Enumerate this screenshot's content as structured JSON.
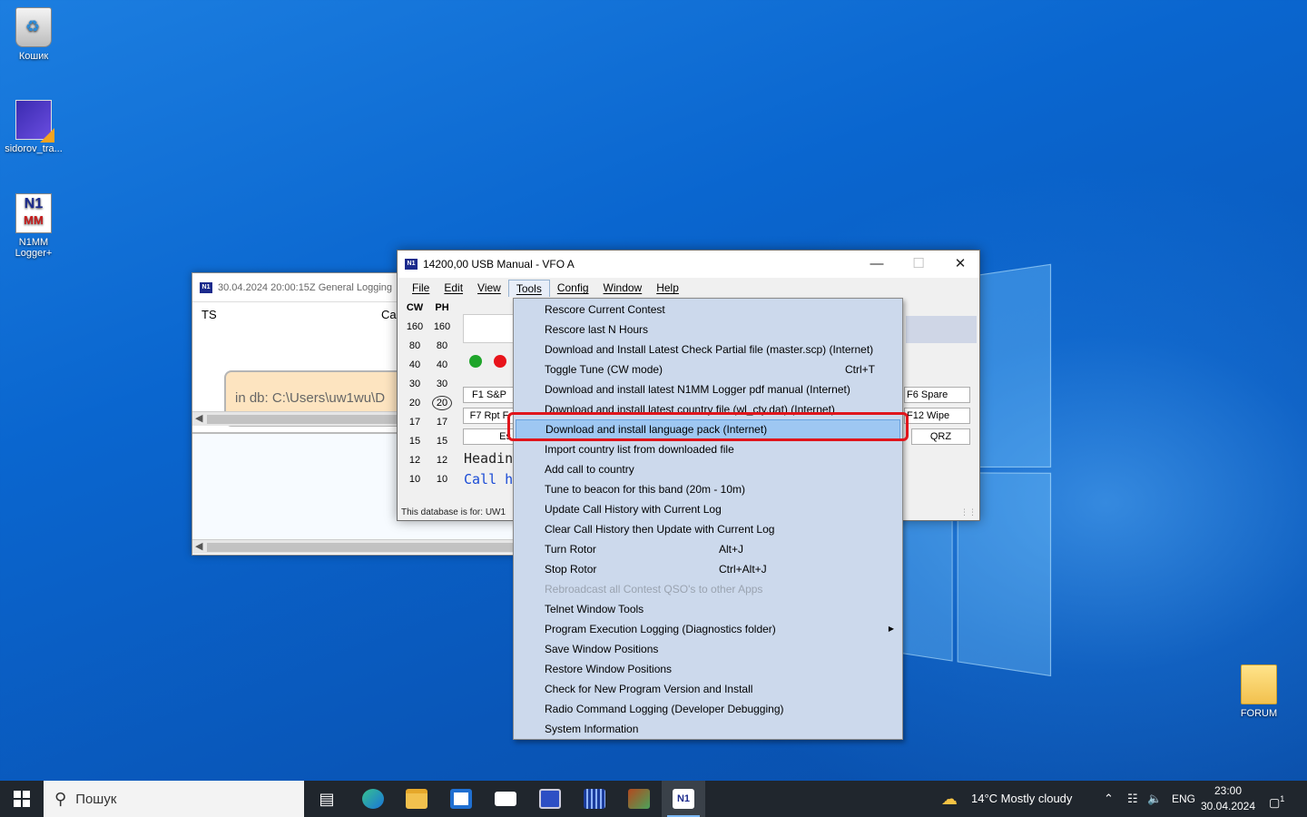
{
  "desktop": {
    "icons": [
      {
        "label": "Кошик"
      },
      {
        "label": "sidorov_tra..."
      },
      {
        "label": "N1MM Logger+"
      },
      {
        "label": "FORUM"
      }
    ]
  },
  "log_window": {
    "title": "30.04.2024 20:00:15Z  General Logging",
    "col_ts": "TS",
    "col_call": "Ca",
    "tooltip": "in db: C:\\Users\\uw1wu\\D"
  },
  "entry_window": {
    "title": "14200,00 USB Manual - VFO A",
    "logo": "N1",
    "menu": [
      "File",
      "Edit",
      "View",
      "Tools",
      "Config",
      "Window",
      "Help"
    ],
    "band_headers": [
      "CW",
      "PH"
    ],
    "bands_cw": [
      "160",
      "80",
      "40",
      "30",
      "20",
      "17",
      "15",
      "12",
      "10"
    ],
    "bands_ph": [
      "160",
      "80",
      "40",
      "30",
      "20",
      "17",
      "15",
      "12",
      "10"
    ],
    "function_keys": {
      "f1": "F1 S&P",
      "f7": "F7 Rpt F",
      "esc": "Es",
      "f6": "F6 Spare",
      "f12": "F12 Wipe",
      "qrz": "QRZ"
    },
    "heading_text": "Headin",
    "call_text": "Call h",
    "status": "This database is for: UW1"
  },
  "tools_menu": {
    "items": [
      {
        "label": "Rescore Current Contest"
      },
      {
        "label": "Rescore last N Hours"
      },
      {
        "label": "Download and Install Latest Check Partial file (master.scp) (Internet)"
      },
      {
        "label": "Toggle Tune (CW mode)",
        "shortcut": "Ctrl+T"
      },
      {
        "label": "Download and install latest N1MM Logger pdf manual (Internet)"
      },
      {
        "label": "Download and install latest country file (wl_cty.dat) (Internet)"
      },
      {
        "label": "Download and install language pack (Internet)"
      },
      {
        "label": "Import country list from downloaded file"
      },
      {
        "label": "Add call to country"
      },
      {
        "label": "Tune to beacon for this band  (20m - 10m)"
      },
      {
        "label": "Update Call History with Current Log"
      },
      {
        "label": "Clear Call History then Update with Current Log"
      },
      {
        "label": "Turn Rotor",
        "shortcut": "Alt+J"
      },
      {
        "label": "Stop Rotor",
        "shortcut": "Ctrl+Alt+J"
      },
      {
        "label": "Rebroadcast all Contest QSO's to other Apps"
      },
      {
        "label": "Telnet Window Tools"
      },
      {
        "label": "Program Execution Logging (Diagnostics folder)"
      },
      {
        "label": "Save Window Positions"
      },
      {
        "label": "Restore Window Positions"
      },
      {
        "label": "Check for New Program Version and Install"
      },
      {
        "label": "Radio Command Logging  (Developer Debugging)"
      },
      {
        "label": "System Information"
      }
    ]
  },
  "taskbar": {
    "search_placeholder": "Пошук",
    "weather": "14°C  Mostly cloudy",
    "language": "ENG",
    "time": "23:00",
    "date": "30.04.2024",
    "notifications": "1"
  }
}
